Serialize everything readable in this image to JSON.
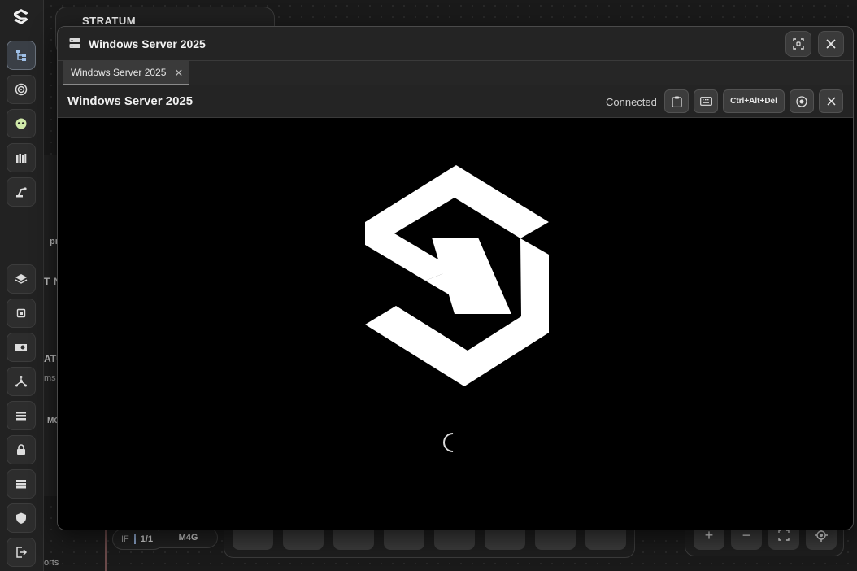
{
  "background": {
    "card_title": "STRATUM",
    "fragments": [
      "pr",
      "T",
      "N",
      "ATU",
      "ms",
      "MC",
      "orts"
    ],
    "interface_pill": {
      "prefix": "IF",
      "value": "1/1",
      "model": "M4G"
    },
    "zoom": {
      "plus": "+",
      "minus": "−"
    }
  },
  "rail": {
    "icons": [
      "hierarchy-icon",
      "target-icon",
      "alien-icon",
      "ammo-icon",
      "robot-arm-icon",
      "layers-icon",
      "chip-icon",
      "gpu-icon",
      "network-icon",
      "list-icon",
      "lock-icon",
      "list-alt-icon",
      "shield-icon",
      "logout-icon"
    ]
  },
  "window": {
    "title": "Windows Server 2025",
    "tab_label": "Windows Server 2025",
    "tab_close": "✕",
    "console_title": "Windows Server 2025",
    "status": "Connected",
    "cad_label": "Ctrl+Alt+Del"
  },
  "colors": {
    "background": "#1a1a1a",
    "window": "#232323",
    "screen": "#000000",
    "button": "#3a3a3a",
    "active_rail": "#3a3f46"
  }
}
